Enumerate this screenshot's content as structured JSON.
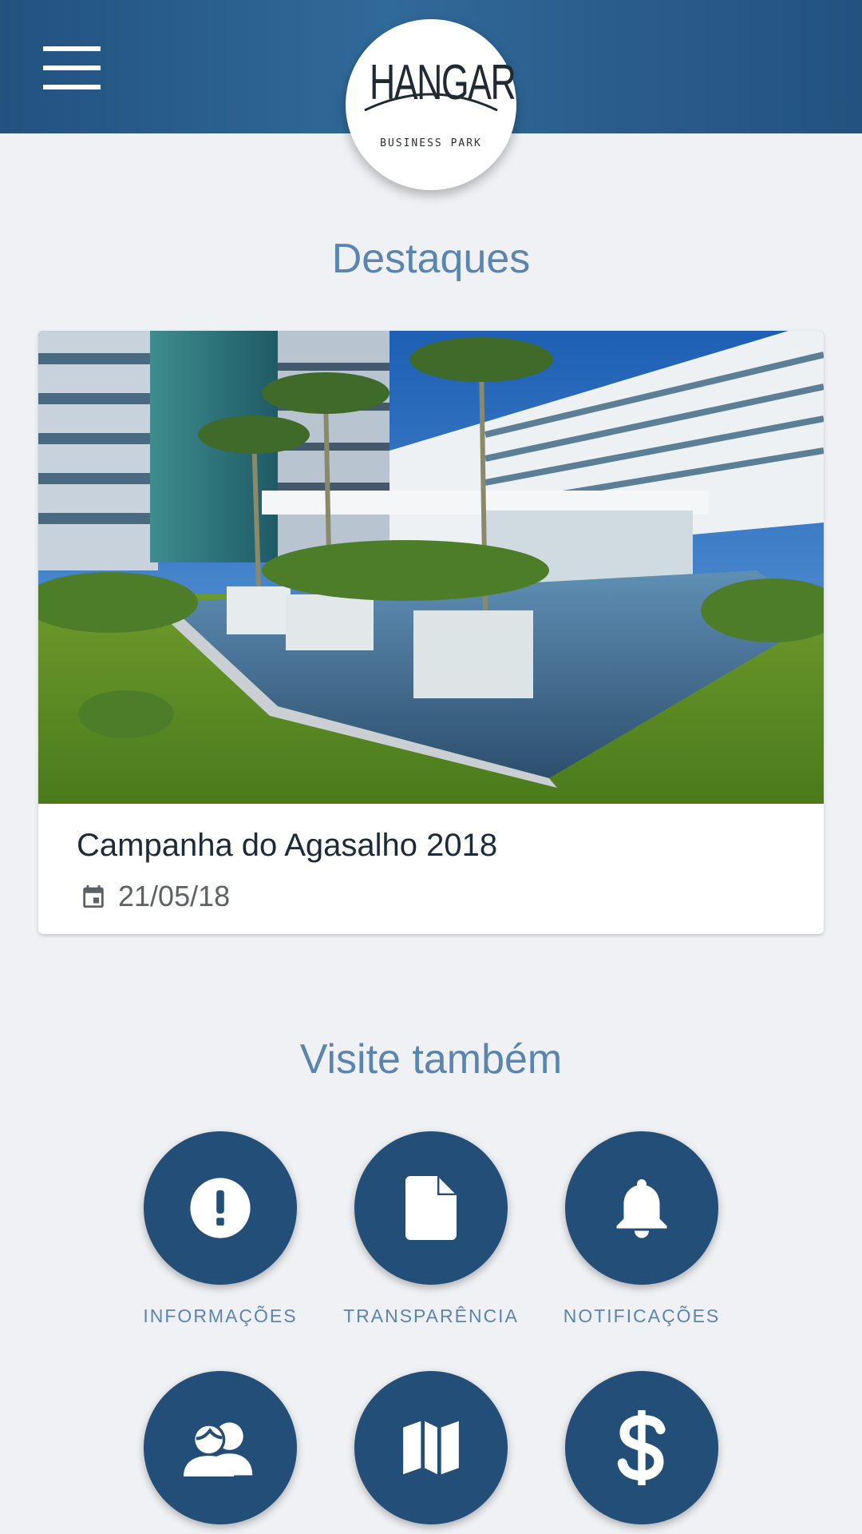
{
  "header": {
    "menu_icon": "hamburger-menu-icon",
    "logo": {
      "title": "HANGAR",
      "subtitle": "BUSINESS PARK"
    }
  },
  "highlights": {
    "title": "Destaques",
    "card": {
      "title": "Campanha do Agasalho 2018",
      "date_icon": "calendar-icon",
      "date": "21/05/18"
    }
  },
  "visit": {
    "title": "Visite também",
    "items": [
      {
        "label": "INFORMAÇÕES",
        "icon": "info-exclamation-icon"
      },
      {
        "label": "TRANSPARÊNCIA",
        "icon": "document-icon"
      },
      {
        "label": "NOTIFICAÇÕES",
        "icon": "bell-icon"
      },
      {
        "label": "",
        "icon": "people-icon"
      },
      {
        "label": "",
        "icon": "map-icon"
      },
      {
        "label": "",
        "icon": "dollar-icon"
      }
    ]
  },
  "colors": {
    "header_blue": "#2b5d8c",
    "accent_text": "#5a85b0",
    "button_navy": "#234e77",
    "background": "#eff1f5"
  }
}
